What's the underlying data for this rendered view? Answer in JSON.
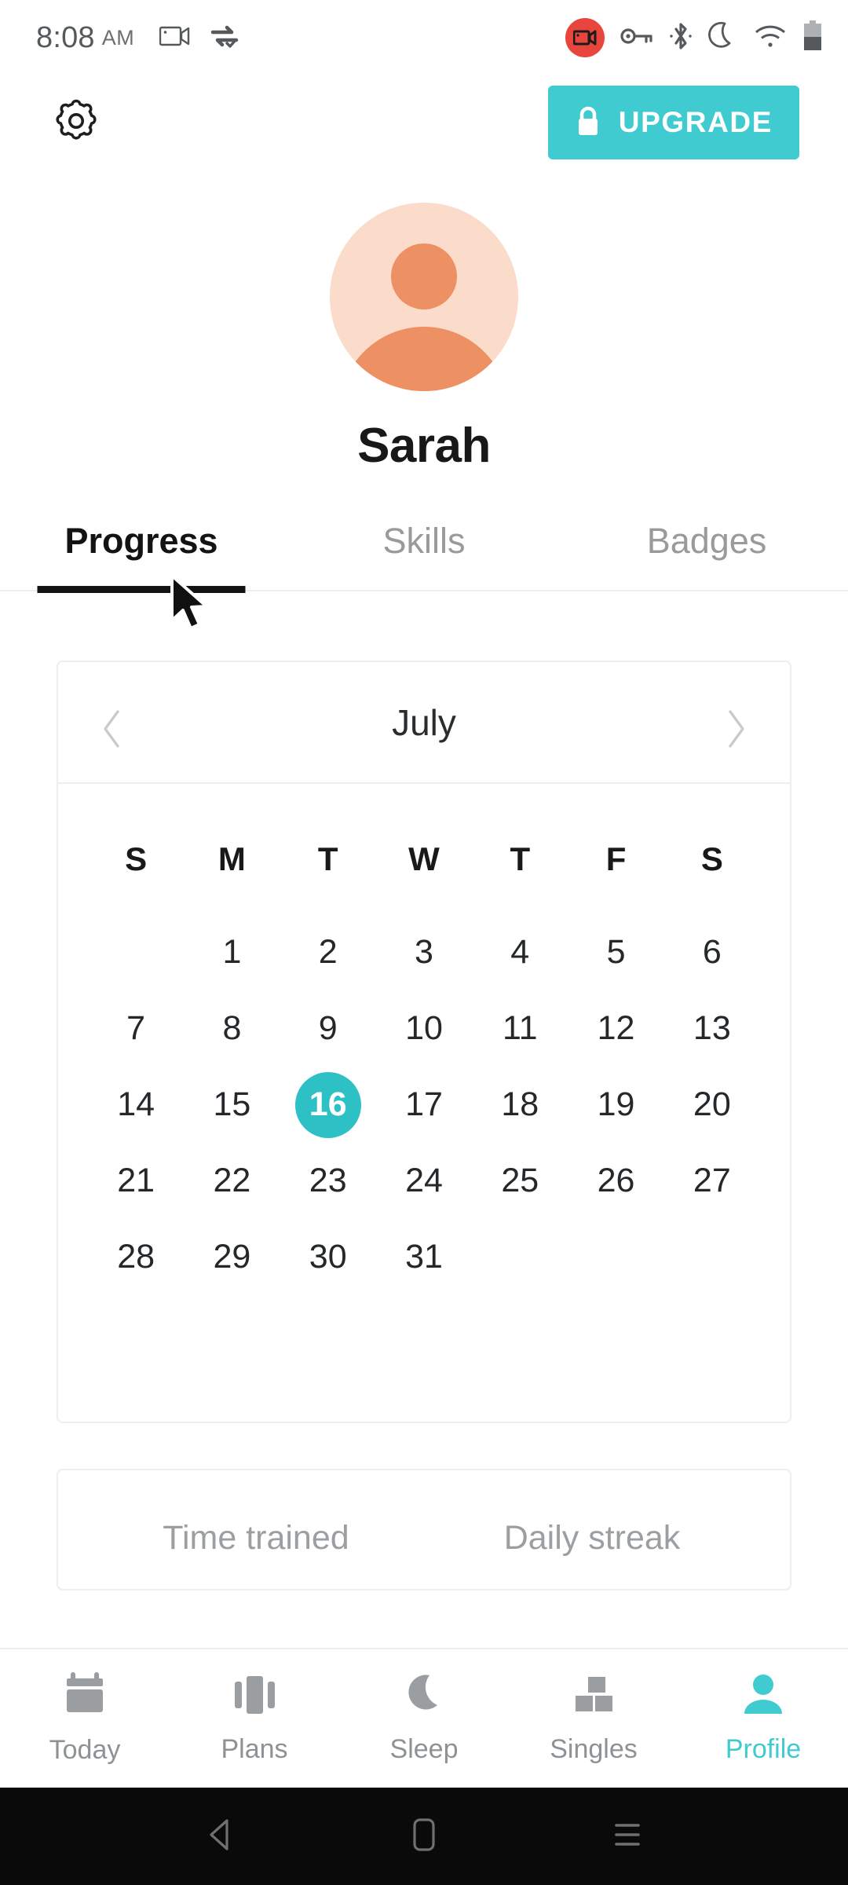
{
  "status_bar": {
    "time": "8:08",
    "ampm": "AM",
    "icons": [
      "video-camera-icon",
      "sync-check-icon",
      "screen-record-icon",
      "vpn-key-icon",
      "bluetooth-icon",
      "do-not-disturb-moon-icon",
      "wifi-icon",
      "battery-icon"
    ],
    "record_badge_color": "#e8453c"
  },
  "header": {
    "settings_icon": "gear-icon",
    "upgrade_label": "UPGRADE",
    "upgrade_icon": "lock-icon",
    "accent_color": "#3fcbcf"
  },
  "profile": {
    "avatar_icon": "person-avatar-icon",
    "avatar_bg": "#fbdcca",
    "avatar_fg": "#ed9063",
    "name": "Sarah"
  },
  "tabs": [
    {
      "label": "Progress",
      "active": true
    },
    {
      "label": "Skills",
      "active": false
    },
    {
      "label": "Badges",
      "active": false
    }
  ],
  "calendar": {
    "month": "July",
    "prev_icon": "chevron-left-icon",
    "next_icon": "chevron-right-icon",
    "weekdays": [
      "S",
      "M",
      "T",
      "W",
      "T",
      "F",
      "S"
    ],
    "selected_day": 16,
    "selected_color": "#2dc1c6",
    "weeks": [
      [
        "",
        "1",
        "2",
        "3",
        "4",
        "5",
        "6"
      ],
      [
        "7",
        "8",
        "9",
        "10",
        "11",
        "12",
        "13"
      ],
      [
        "14",
        "15",
        "16",
        "17",
        "18",
        "19",
        "20"
      ],
      [
        "21",
        "22",
        "23",
        "24",
        "25",
        "26",
        "27"
      ],
      [
        "28",
        "29",
        "30",
        "31",
        "",
        "",
        ""
      ],
      [
        "",
        "",
        "",
        "",
        "",
        "",
        ""
      ]
    ]
  },
  "stats": {
    "time_trained_label": "Time trained",
    "daily_streak_label": "Daily streak"
  },
  "bottom_nav": [
    {
      "label": "Today",
      "icon": "calendar-icon",
      "active": false
    },
    {
      "label": "Plans",
      "icon": "cards-stack-icon",
      "active": false
    },
    {
      "label": "Sleep",
      "icon": "moon-icon",
      "active": false
    },
    {
      "label": "Singles",
      "icon": "blocks-icon",
      "active": false
    },
    {
      "label": "Profile",
      "icon": "person-icon",
      "active": true
    }
  ],
  "android_nav": {
    "back_icon": "back-triangle-icon",
    "home_icon": "home-square-icon",
    "recents_icon": "recents-menu-icon"
  }
}
